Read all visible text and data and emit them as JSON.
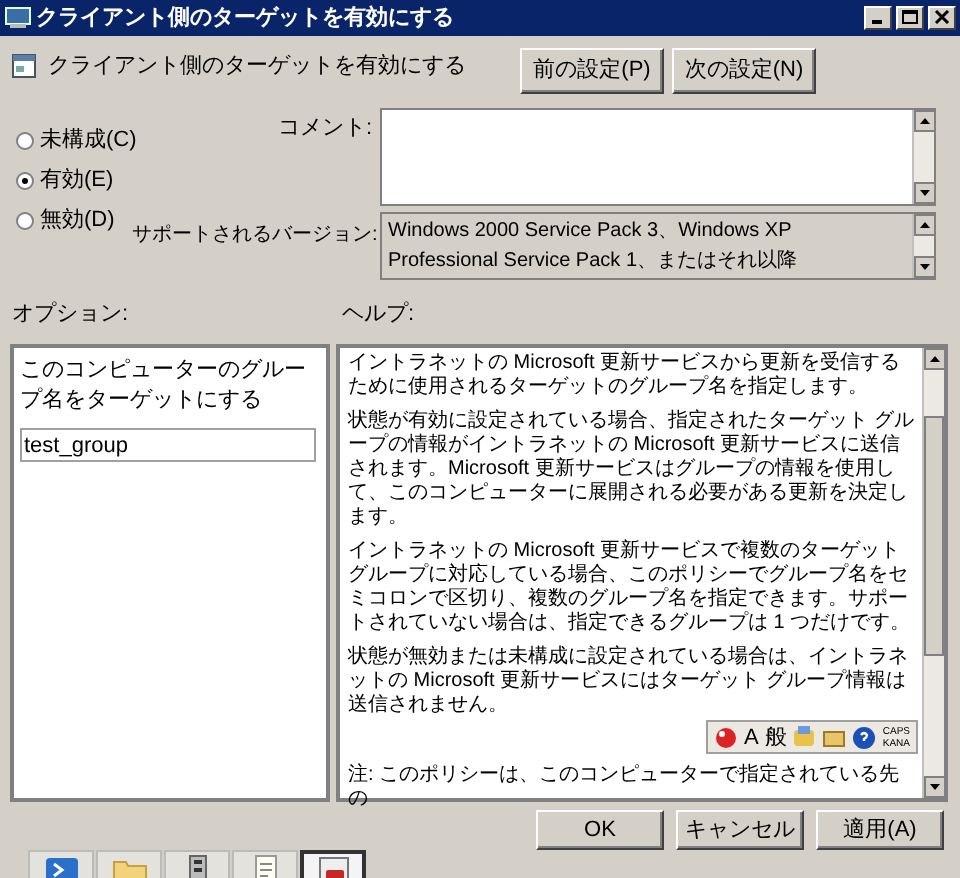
{
  "window": {
    "title": "クライアント側のターゲットを有効にする"
  },
  "header": {
    "policy_name": "クライアント側のターゲットを有効にする",
    "buttons": [
      {
        "label": "前の設定(P)"
      },
      {
        "label": "次の設定(N)"
      }
    ]
  },
  "state_options": [
    {
      "label": "未構成(C)",
      "selected": false
    },
    {
      "label": "有効(E)",
      "selected": true
    },
    {
      "label": "無効(D)",
      "selected": false
    }
  ],
  "comment": {
    "label": "コメント:"
  },
  "supported": {
    "label": "サポートされるバージョン:",
    "value": "Windows 2000 Service Pack 3、Windows XP Professional Service Pack 1、またはそれ以降"
  },
  "options": {
    "label": "オプション:",
    "description": "このコンピューターのグループ名をターゲットにする",
    "field_value": "test_group"
  },
  "help": {
    "label": "ヘルプ:",
    "paragraphs": [
      "イントラネットの Microsoft 更新サービスから更新を受信するために使用されるターゲットのグループ名を指定します。",
      "状態が有効に設定されている場合、指定されたターゲット グループの情報がイントラネットの Microsoft 更新サービスに送信されます。Microsoft 更新サービスはグループの情報を使用して、このコンピューターに展開される必要がある更新を決定します。",
      "イントラネットの Microsoft 更新サービスで複数のターゲットグループに対応している場合、このポリシーでグループ名をセミコロンで区切り、複数のグループ名を指定できます。サポートされていない場合は、指定できるグループは 1 つだけです。",
      "状態が無効または未構成に設定されている場合は、イントラネットの Microsoft 更新サービスにはターゲット グループ情報は送信されません。",
      "注: このポリシーは、このコンピューターで指定されている先の"
    ],
    "ime_toolbar": {
      "texts": [
        "A",
        "般",
        "CAPS",
        "KANA"
      ]
    }
  },
  "footer_buttons": [
    "OK",
    "キャンセル",
    "適用(A)"
  ],
  "taskbar": {
    "items": [
      {
        "kind": "shell",
        "selected": false
      },
      {
        "kind": "folder",
        "selected": false
      },
      {
        "kind": "tools",
        "selected": false
      },
      {
        "kind": "notepad",
        "selected": false
      },
      {
        "kind": "app",
        "selected": true
      }
    ]
  }
}
